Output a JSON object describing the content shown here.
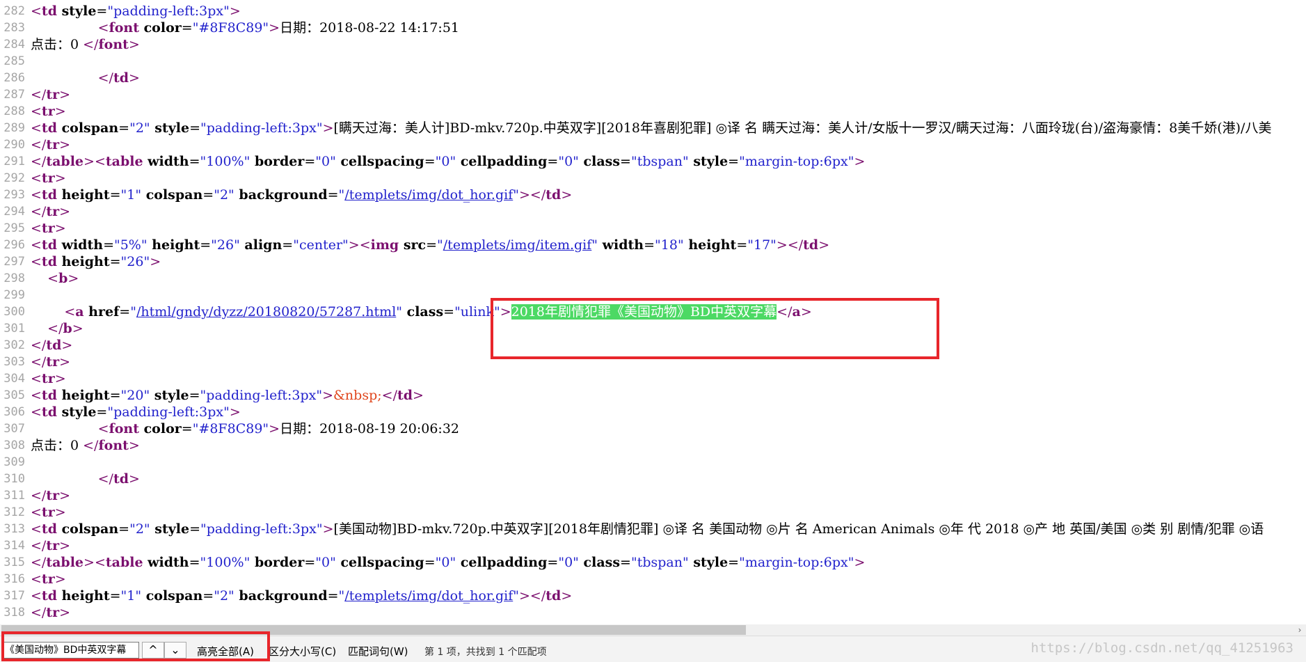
{
  "editor": {
    "lines": [
      {
        "n": "282",
        "spans": [
          [
            "b",
            "<"
          ],
          [
            "tag",
            "td"
          ],
          [
            "at",
            " style"
          ],
          [
            "txt",
            "="
          ],
          [
            "str",
            "\"padding-left:3px\""
          ],
          [
            "b",
            ">"
          ]
        ]
      },
      {
        "n": "283",
        "spans": [
          [
            "txt",
            "                "
          ],
          [
            "b",
            "<"
          ],
          [
            "tag",
            "font"
          ],
          [
            "at",
            " color"
          ],
          [
            "txt",
            "="
          ],
          [
            "str",
            "\"#8F8C89\""
          ],
          [
            "b",
            ">"
          ],
          [
            "txt",
            "日期：2018-08-22 14:17:51"
          ]
        ]
      },
      {
        "n": "284",
        "spans": [
          [
            "txt",
            "点击：0 "
          ],
          [
            "b",
            "</"
          ],
          [
            "tag",
            "font"
          ],
          [
            "b",
            ">"
          ]
        ]
      },
      {
        "n": "285",
        "spans": []
      },
      {
        "n": "286",
        "spans": [
          [
            "txt",
            "                "
          ],
          [
            "b",
            "</"
          ],
          [
            "tag",
            "td"
          ],
          [
            "b",
            ">"
          ]
        ]
      },
      {
        "n": "287",
        "spans": [
          [
            "b",
            "</"
          ],
          [
            "tag",
            "tr"
          ],
          [
            "b",
            ">"
          ]
        ]
      },
      {
        "n": "288",
        "spans": [
          [
            "b",
            "<"
          ],
          [
            "tag",
            "tr"
          ],
          [
            "b",
            ">"
          ]
        ]
      },
      {
        "n": "289",
        "spans": [
          [
            "b",
            "<"
          ],
          [
            "tag",
            "td"
          ],
          [
            "at",
            " colspan"
          ],
          [
            "txt",
            "="
          ],
          [
            "str",
            "\"2\""
          ],
          [
            "at",
            " style"
          ],
          [
            "txt",
            "="
          ],
          [
            "str",
            "\"padding-left:3px\""
          ],
          [
            "b",
            ">"
          ],
          [
            "txt",
            "[瞒天过海：美人计]BD-mkv.720p.中英双字][2018年喜剧犯罪] ◎译 名 瞒天过海：美人计/女版十一罗汉/瞒天过海：八面玲珑(台)/盗海豪情：8美千娇(港)/八美"
          ]
        ]
      },
      {
        "n": "290",
        "spans": [
          [
            "b",
            "</"
          ],
          [
            "tag",
            "tr"
          ],
          [
            "b",
            ">"
          ]
        ]
      },
      {
        "n": "291",
        "spans": [
          [
            "b",
            "</"
          ],
          [
            "tag",
            "table"
          ],
          [
            "b",
            ">"
          ],
          [
            "b",
            "<"
          ],
          [
            "tag",
            "table"
          ],
          [
            "at",
            " width"
          ],
          [
            "txt",
            "="
          ],
          [
            "str",
            "\"100%\""
          ],
          [
            "at",
            " border"
          ],
          [
            "txt",
            "="
          ],
          [
            "str",
            "\"0\""
          ],
          [
            "at",
            " cellspacing"
          ],
          [
            "txt",
            "="
          ],
          [
            "str",
            "\"0\""
          ],
          [
            "at",
            " cellpadding"
          ],
          [
            "txt",
            "="
          ],
          [
            "str",
            "\"0\""
          ],
          [
            "at",
            " class"
          ],
          [
            "txt",
            "="
          ],
          [
            "str",
            "\"tbspan\""
          ],
          [
            "at",
            " style"
          ],
          [
            "txt",
            "="
          ],
          [
            "str",
            "\"margin-top:6px\""
          ],
          [
            "b",
            ">"
          ]
        ]
      },
      {
        "n": "292",
        "spans": [
          [
            "b",
            "<"
          ],
          [
            "tag",
            "tr"
          ],
          [
            "b",
            ">"
          ]
        ]
      },
      {
        "n": "293",
        "spans": [
          [
            "b",
            "<"
          ],
          [
            "tag",
            "td"
          ],
          [
            "at",
            " height"
          ],
          [
            "txt",
            "="
          ],
          [
            "str",
            "\"1\""
          ],
          [
            "at",
            " colspan"
          ],
          [
            "txt",
            "="
          ],
          [
            "str",
            "\"2\""
          ],
          [
            "at",
            " background"
          ],
          [
            "txt",
            "="
          ],
          [
            "str",
            "\""
          ],
          [
            "link",
            "/templets/img/dot_hor.gif"
          ],
          [
            "str",
            "\""
          ],
          [
            "b",
            "></"
          ],
          [
            "tag",
            "td"
          ],
          [
            "b",
            ">"
          ]
        ]
      },
      {
        "n": "294",
        "spans": [
          [
            "b",
            "</"
          ],
          [
            "tag",
            "tr"
          ],
          [
            "b",
            ">"
          ]
        ]
      },
      {
        "n": "295",
        "spans": [
          [
            "b",
            "<"
          ],
          [
            "tag",
            "tr"
          ],
          [
            "b",
            ">"
          ]
        ]
      },
      {
        "n": "296",
        "spans": [
          [
            "b",
            "<"
          ],
          [
            "tag",
            "td"
          ],
          [
            "at",
            " width"
          ],
          [
            "txt",
            "="
          ],
          [
            "str",
            "\"5%\""
          ],
          [
            "at",
            " height"
          ],
          [
            "txt",
            "="
          ],
          [
            "str",
            "\"26\""
          ],
          [
            "at",
            " align"
          ],
          [
            "txt",
            "="
          ],
          [
            "str",
            "\"center\""
          ],
          [
            "b",
            ">"
          ],
          [
            "b",
            "<"
          ],
          [
            "tag",
            "img"
          ],
          [
            "at",
            " src"
          ],
          [
            "txt",
            "="
          ],
          [
            "str",
            "\""
          ],
          [
            "link",
            "/templets/img/item.gif"
          ],
          [
            "str",
            "\""
          ],
          [
            "at",
            " width"
          ],
          [
            "txt",
            "="
          ],
          [
            "str",
            "\"18\""
          ],
          [
            "at",
            " height"
          ],
          [
            "txt",
            "="
          ],
          [
            "str",
            "\"17\""
          ],
          [
            "b",
            "></"
          ],
          [
            "tag",
            "td"
          ],
          [
            "b",
            ">"
          ]
        ]
      },
      {
        "n": "297",
        "spans": [
          [
            "b",
            "<"
          ],
          [
            "tag",
            "td"
          ],
          [
            "at",
            " height"
          ],
          [
            "txt",
            "="
          ],
          [
            "str",
            "\"26\""
          ],
          [
            "b",
            ">"
          ]
        ]
      },
      {
        "n": "298",
        "spans": [
          [
            "txt",
            "    "
          ],
          [
            "b",
            "<"
          ],
          [
            "tag",
            "b"
          ],
          [
            "b",
            ">"
          ]
        ]
      },
      {
        "n": "299",
        "spans": []
      },
      {
        "n": "300",
        "spans": [
          [
            "txt",
            "        "
          ],
          [
            "b",
            "<"
          ],
          [
            "tag",
            "a"
          ],
          [
            "at",
            " href"
          ],
          [
            "txt",
            "="
          ],
          [
            "str",
            "\""
          ],
          [
            "link",
            "/html/gndy/dyzz/20180820/57287.html"
          ],
          [
            "str",
            "\""
          ],
          [
            "at",
            " class"
          ],
          [
            "txt",
            "="
          ],
          [
            "str",
            "\"ulink\""
          ],
          [
            "b",
            ">"
          ],
          [
            "hl",
            "2018年剧情犯罪《美国动物》BD中英双字幕"
          ],
          [
            "b",
            "</"
          ],
          [
            "tag",
            "a"
          ],
          [
            "b",
            ">"
          ]
        ]
      },
      {
        "n": "301",
        "spans": [
          [
            "txt",
            "    "
          ],
          [
            "b",
            "</"
          ],
          [
            "tag",
            "b"
          ],
          [
            "b",
            ">"
          ]
        ]
      },
      {
        "n": "302",
        "spans": [
          [
            "b",
            "</"
          ],
          [
            "tag",
            "td"
          ],
          [
            "b",
            ">"
          ]
        ]
      },
      {
        "n": "303",
        "spans": [
          [
            "b",
            "</"
          ],
          [
            "tag",
            "tr"
          ],
          [
            "b",
            ">"
          ]
        ]
      },
      {
        "n": "304",
        "spans": [
          [
            "b",
            "<"
          ],
          [
            "tag",
            "tr"
          ],
          [
            "b",
            ">"
          ]
        ]
      },
      {
        "n": "305",
        "spans": [
          [
            "b",
            "<"
          ],
          [
            "tag",
            "td"
          ],
          [
            "at",
            " height"
          ],
          [
            "txt",
            "="
          ],
          [
            "str",
            "\"20\""
          ],
          [
            "at",
            " style"
          ],
          [
            "txt",
            "="
          ],
          [
            "str",
            "\"padding-left:3px\""
          ],
          [
            "b",
            ">"
          ],
          [
            "ent",
            "&nbsp;"
          ],
          [
            "b",
            "</"
          ],
          [
            "tag",
            "td"
          ],
          [
            "b",
            ">"
          ]
        ]
      },
      {
        "n": "306",
        "spans": [
          [
            "b",
            "<"
          ],
          [
            "tag",
            "td"
          ],
          [
            "at",
            " style"
          ],
          [
            "txt",
            "="
          ],
          [
            "str",
            "\"padding-left:3px\""
          ],
          [
            "b",
            ">"
          ]
        ]
      },
      {
        "n": "307",
        "spans": [
          [
            "txt",
            "                "
          ],
          [
            "b",
            "<"
          ],
          [
            "tag",
            "font"
          ],
          [
            "at",
            " color"
          ],
          [
            "txt",
            "="
          ],
          [
            "str",
            "\"#8F8C89\""
          ],
          [
            "b",
            ">"
          ],
          [
            "txt",
            "日期：2018-08-19 20:06:32"
          ]
        ]
      },
      {
        "n": "308",
        "spans": [
          [
            "txt",
            "点击：0 "
          ],
          [
            "b",
            "</"
          ],
          [
            "tag",
            "font"
          ],
          [
            "b",
            ">"
          ]
        ]
      },
      {
        "n": "309",
        "spans": []
      },
      {
        "n": "310",
        "spans": [
          [
            "txt",
            "                "
          ],
          [
            "b",
            "</"
          ],
          [
            "tag",
            "td"
          ],
          [
            "b",
            ">"
          ]
        ]
      },
      {
        "n": "311",
        "spans": [
          [
            "b",
            "</"
          ],
          [
            "tag",
            "tr"
          ],
          [
            "b",
            ">"
          ]
        ]
      },
      {
        "n": "312",
        "spans": [
          [
            "b",
            "<"
          ],
          [
            "tag",
            "tr"
          ],
          [
            "b",
            ">"
          ]
        ]
      },
      {
        "n": "313",
        "spans": [
          [
            "b",
            "<"
          ],
          [
            "tag",
            "td"
          ],
          [
            "at",
            " colspan"
          ],
          [
            "txt",
            "="
          ],
          [
            "str",
            "\"2\""
          ],
          [
            "at",
            " style"
          ],
          [
            "txt",
            "="
          ],
          [
            "str",
            "\"padding-left:3px\""
          ],
          [
            "b",
            ">"
          ],
          [
            "txt",
            "[美国动物]BD-mkv.720p.中英双字][2018年剧情犯罪] ◎译 名 美国动物 ◎片 名 American Animals ◎年 代 2018 ◎产 地 英国/美国 ◎类 别 剧情/犯罪 ◎语"
          ]
        ]
      },
      {
        "n": "314",
        "spans": [
          [
            "b",
            "</"
          ],
          [
            "tag",
            "tr"
          ],
          [
            "b",
            ">"
          ]
        ]
      },
      {
        "n": "315",
        "spans": [
          [
            "b",
            "</"
          ],
          [
            "tag",
            "table"
          ],
          [
            "b",
            ">"
          ],
          [
            "b",
            "<"
          ],
          [
            "tag",
            "table"
          ],
          [
            "at",
            " width"
          ],
          [
            "txt",
            "="
          ],
          [
            "str",
            "\"100%\""
          ],
          [
            "at",
            " border"
          ],
          [
            "txt",
            "="
          ],
          [
            "str",
            "\"0\""
          ],
          [
            "at",
            " cellspacing"
          ],
          [
            "txt",
            "="
          ],
          [
            "str",
            "\"0\""
          ],
          [
            "at",
            " cellpadding"
          ],
          [
            "txt",
            "="
          ],
          [
            "str",
            "\"0\""
          ],
          [
            "at",
            " class"
          ],
          [
            "txt",
            "="
          ],
          [
            "str",
            "\"tbspan\""
          ],
          [
            "at",
            " style"
          ],
          [
            "txt",
            "="
          ],
          [
            "str",
            "\"margin-top:6px\""
          ],
          [
            "b",
            ">"
          ]
        ]
      },
      {
        "n": "316",
        "spans": [
          [
            "b",
            "<"
          ],
          [
            "tag",
            "tr"
          ],
          [
            "b",
            ">"
          ]
        ]
      },
      {
        "n": "317",
        "spans": [
          [
            "b",
            "<"
          ],
          [
            "tag",
            "td"
          ],
          [
            "at",
            " height"
          ],
          [
            "txt",
            "="
          ],
          [
            "str",
            "\"1\""
          ],
          [
            "at",
            " colspan"
          ],
          [
            "txt",
            "="
          ],
          [
            "str",
            "\"2\""
          ],
          [
            "at",
            " background"
          ],
          [
            "txt",
            "="
          ],
          [
            "str",
            "\""
          ],
          [
            "link",
            "/templets/img/dot_hor.gif"
          ],
          [
            "str",
            "\""
          ],
          [
            "b",
            "></"
          ],
          [
            "tag",
            "td"
          ],
          [
            "b",
            ">"
          ]
        ]
      },
      {
        "n": "318",
        "spans": [
          [
            "b",
            "</"
          ],
          [
            "tag",
            "tr"
          ],
          [
            "b",
            ">"
          ]
        ]
      }
    ]
  },
  "scrollbar": {
    "right_arrow": "›"
  },
  "findbar": {
    "search_value": "《美国动物》BD中英双字幕",
    "prev_glyph": "^",
    "next_glyph": "⌄",
    "highlight_all": "高亮全部(A)",
    "match_case": "区分大小写(C)",
    "whole_word": "匹配词句(W)",
    "status": "第 1 项，共找到 1 个匹配项"
  },
  "watermark": "https://blog.csdn.net/qq_41251963",
  "colors": {
    "highlight": "#4cd964",
    "annotation_red": "#e8262b"
  }
}
